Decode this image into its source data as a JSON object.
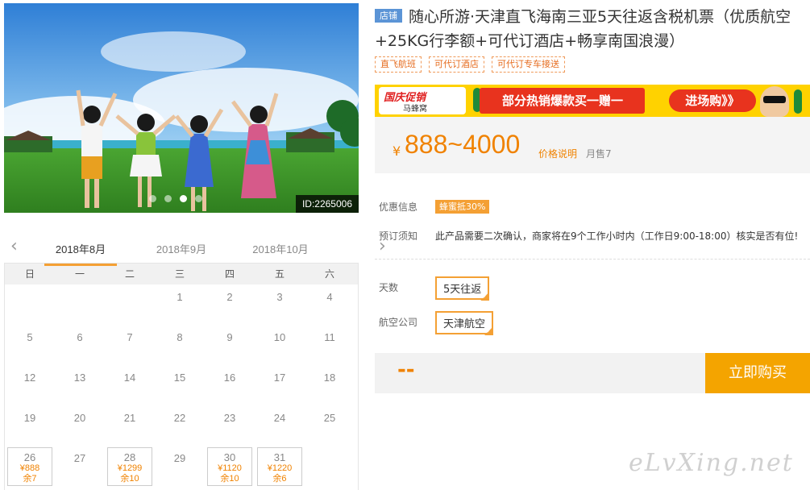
{
  "photo": {
    "id_label": "ID:2265006"
  },
  "calendar": {
    "months": [
      "2018年8月",
      "2018年9月",
      "2018年10月"
    ],
    "weekdays": [
      "日",
      "一",
      "二",
      "三",
      "四",
      "五",
      "六"
    ],
    "days": [
      {
        "d": ""
      },
      {
        "d": ""
      },
      {
        "d": ""
      },
      {
        "d": "1"
      },
      {
        "d": "2"
      },
      {
        "d": "3"
      },
      {
        "d": "4"
      },
      {
        "d": "5"
      },
      {
        "d": "6"
      },
      {
        "d": "7"
      },
      {
        "d": "8"
      },
      {
        "d": "9"
      },
      {
        "d": "10"
      },
      {
        "d": "11"
      },
      {
        "d": "12"
      },
      {
        "d": "13"
      },
      {
        "d": "14"
      },
      {
        "d": "15"
      },
      {
        "d": "16"
      },
      {
        "d": "17"
      },
      {
        "d": "18"
      },
      {
        "d": "19"
      },
      {
        "d": "20"
      },
      {
        "d": "21"
      },
      {
        "d": "22"
      },
      {
        "d": "23"
      },
      {
        "d": "24"
      },
      {
        "d": "25"
      },
      {
        "d": "26",
        "price": "¥888",
        "left": "余7"
      },
      {
        "d": "27"
      },
      {
        "d": "28",
        "price": "¥1299",
        "left": "余10"
      },
      {
        "d": "29"
      },
      {
        "d": "30",
        "price": "¥1120",
        "left": "余10"
      },
      {
        "d": "31",
        "price": "¥1220",
        "left": "余6"
      },
      {
        "d": ""
      }
    ]
  },
  "product": {
    "shop_badge": "店铺",
    "title": "随心所游·天津直飞海南三亚5天往返含税机票（优质航空+25KG行李额+可代订酒店+畅享南国浪漫）",
    "tags": [
      "直飞航班",
      "可代订酒店",
      "可代订专车接送"
    ]
  },
  "banner": {
    "logo_top": "国庆促销",
    "logo_bottom": "马蜂窝",
    "promo_text": "部分热销爆款买一赠一",
    "cta": "进场购》》"
  },
  "price": {
    "currency": "¥",
    "range": "888~4000",
    "note": "价格说明",
    "sold": "月售7"
  },
  "info": {
    "discount_label": "优惠信息",
    "discount_value": "蜂蜜抵30%",
    "booking_label": "预订须知",
    "booking_value": "此产品需要二次确认，商家将在9个工作小时内（工作日9:00-18:00）核实是否有位!"
  },
  "options": {
    "days_label": "天数",
    "days_value": "5天往返",
    "airline_label": "航空公司",
    "airline_value": "天津航空"
  },
  "buy": {
    "total": "--",
    "button": "立即购买"
  },
  "watermark": "eLvXing.net",
  "colors": {
    "accent": "#f4a034",
    "price": "#f08200",
    "badge": "#5b94d6"
  }
}
